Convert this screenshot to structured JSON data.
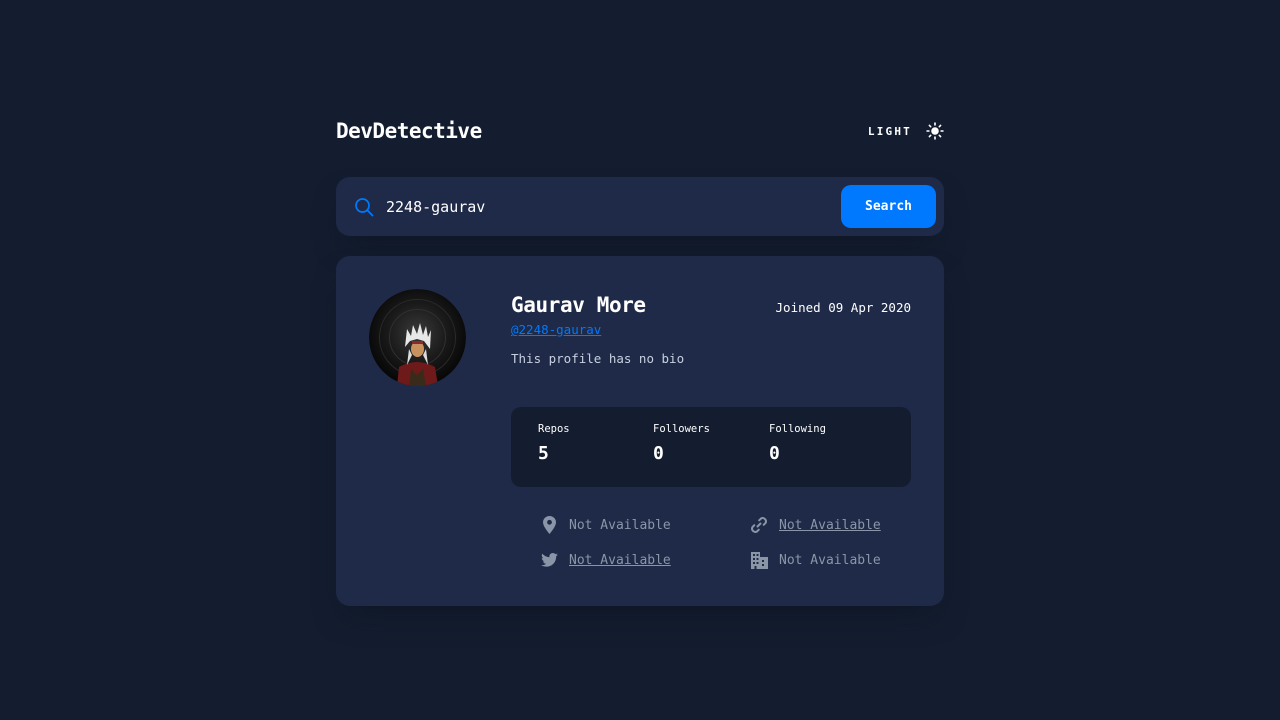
{
  "header": {
    "brand": "DevDetective",
    "theme_label": "LIGHT"
  },
  "search": {
    "value": "2248-gaurav",
    "button_label": "Search"
  },
  "profile": {
    "name": "Gaurav More",
    "joined": "Joined 09 Apr 2020",
    "login": "@2248-gaurav",
    "bio": "This profile has no bio"
  },
  "stats": {
    "repos_label": "Repos",
    "repos_value": "5",
    "followers_label": "Followers",
    "followers_value": "0",
    "following_label": "Following",
    "following_value": "0"
  },
  "links": {
    "location": "Not Available",
    "website": "Not Available",
    "twitter": "Not Available",
    "company": "Not Available"
  },
  "colors": {
    "background": "#141d2f",
    "card": "#1e2a47",
    "accent": "#0079ff",
    "muted": "#8b95a8"
  }
}
